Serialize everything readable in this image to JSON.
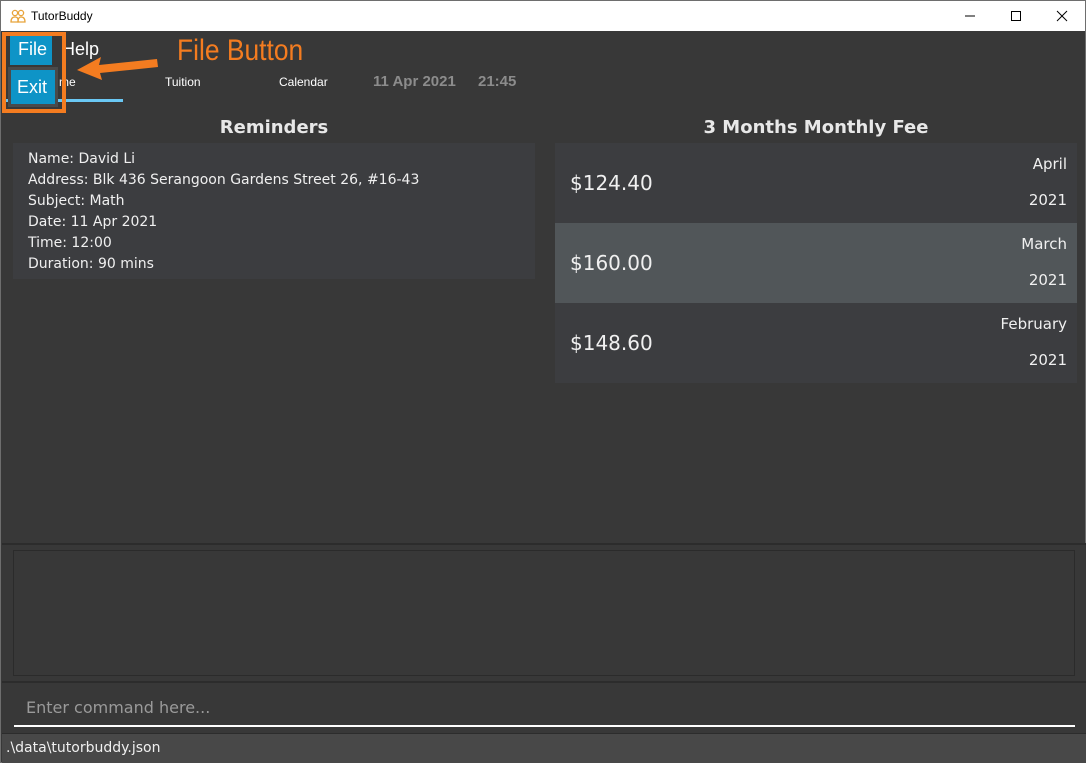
{
  "window": {
    "title": "TutorBuddy",
    "icon": "people-icon",
    "controls": [
      "minimize-icon",
      "maximize-icon",
      "close-icon"
    ]
  },
  "menu": {
    "items": [
      {
        "label": "File",
        "active": true
      },
      {
        "label": "Help",
        "active": false
      }
    ],
    "dropdown": {
      "items": [
        {
          "label": "Exit"
        }
      ]
    }
  },
  "tabs": {
    "items": [
      {
        "label": "Home",
        "selected": true
      },
      {
        "label": "Tuition",
        "selected": false
      },
      {
        "label": "Calendar",
        "selected": false
      }
    ],
    "visible_home_fragment": "me"
  },
  "clock": {
    "date": "11 Apr 2021",
    "time": "21:45"
  },
  "annotation": {
    "label": "File Button",
    "color": "#f47c20"
  },
  "reminders": {
    "title": "Reminders",
    "items": [
      {
        "lines": [
          "Name: David Li",
          "Address: Blk 436 Serangoon Gardens Street 26, #16-43",
          "Subject: Math",
          "Date: 11 Apr 2021",
          "Time: 12:00",
          "Duration: 90 mins"
        ]
      }
    ]
  },
  "fees": {
    "title": "3 Months Monthly Fee",
    "items": [
      {
        "amount": "$124.40",
        "month": "April",
        "year": "2021",
        "selected": false
      },
      {
        "amount": "$160.00",
        "month": "March",
        "year": "2021",
        "selected": true
      },
      {
        "amount": "$148.60",
        "month": "February",
        "year": "2021",
        "selected": false
      }
    ]
  },
  "result_display": {
    "text": ""
  },
  "command": {
    "placeholder": "Enter command here...",
    "value": ""
  },
  "status_bar": {
    "path": ".\\data\\tutorbuddy.json"
  },
  "colors": {
    "accent": "#0e94c7",
    "tab_underline": "#6ac8f4",
    "background": "#383838",
    "card": "#3c3d40",
    "selected_card": "#515659",
    "annotation": "#f47c20"
  }
}
